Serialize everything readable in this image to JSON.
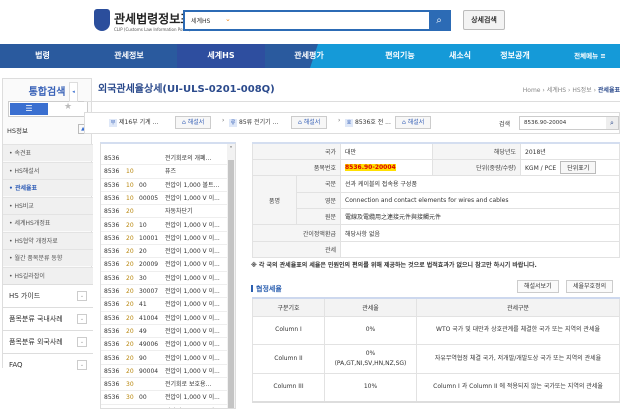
{
  "header": {
    "logo_title": "관세법령정보포털",
    "logo_sub": "CLIP (Customs Law Information Portal)",
    "search_scope": "세계HS",
    "search_value": "",
    "advanced_search": "상세검색"
  },
  "nav": {
    "items": [
      "법령",
      "관세정보",
      "세계HS",
      "관세평가",
      "편의기능",
      "새소식",
      "정보공개",
      "전체메뉴 ≡"
    ],
    "active": "세계HS"
  },
  "sidebar": {
    "title": "통합검색",
    "section": "HS정보",
    "subitems": [
      "속견표",
      "HS해설서",
      "관세율표",
      "HS비교",
      "세계HS개정표",
      "HS협약 개정자료",
      "월간 품목분류 동향",
      "HS길라잡이"
    ],
    "active": "관세율표",
    "groups": [
      "HS 가이드",
      "품목분류 국내사례",
      "품목분류 외국사례",
      "FAQ"
    ]
  },
  "page": {
    "title": "외국관세율상세(UI-ULS-0201-008Q)",
    "breadcrumb": [
      "Home",
      "세계HS",
      "HS정보",
      "관세율표"
    ]
  },
  "filter": {
    "chips": [
      {
        "k": "부",
        "text": "제16부 기계 ..."
      },
      {
        "k": "류",
        "text": "85류 전기기 ..."
      },
      {
        "k": "호",
        "text": "8536호 전 ..."
      }
    ],
    "btn": "해설서",
    "search_label": "검색",
    "search_value": "8536.90-20004"
  },
  "list": [
    [
      "8536",
      "",
      "",
      "전기회로의 개폐..."
    ],
    [
      "8536",
      "10",
      "",
      "퓨즈"
    ],
    [
      "8536",
      "10",
      "00",
      "전압이 1,000 볼트..."
    ],
    [
      "8536",
      "10",
      "00005",
      "전압이 1,000 V 이..."
    ],
    [
      "8536",
      "20",
      "",
      "자동차단기"
    ],
    [
      "8536",
      "20",
      "10",
      "전압이 1,000 V 이..."
    ],
    [
      "8536",
      "20",
      "10001",
      "전압이 1,000 V 이..."
    ],
    [
      "8536",
      "20",
      "20",
      "전압이 1,000 V 이..."
    ],
    [
      "8536",
      "20",
      "20009",
      "전압이 1,000 V 이..."
    ],
    [
      "8536",
      "20",
      "30",
      "전압이 1,000 V 이..."
    ],
    [
      "8536",
      "20",
      "30007",
      "전압이 1,000 V 이..."
    ],
    [
      "8536",
      "20",
      "41",
      "전압이 1,000 V 이..."
    ],
    [
      "8536",
      "20",
      "41004",
      "전압이 1,000 V 이..."
    ],
    [
      "8536",
      "20",
      "49",
      "전압이 1,000 V 이..."
    ],
    [
      "8536",
      "20",
      "49006",
      "전압이 1,000 V 이..."
    ],
    [
      "8536",
      "20",
      "90",
      "전압이 1,000 V 이..."
    ],
    [
      "8536",
      "20",
      "90004",
      "전압이 1,000 V 이..."
    ],
    [
      "8536",
      "30",
      "",
      "전기회로 보호용..."
    ],
    [
      "8536",
      "30",
      "00",
      "전압이 1,000 V 이..."
    ],
    [
      "8536",
      "30",
      "00001",
      "전압이 1,000 V 이..."
    ]
  ],
  "detail": {
    "country_label": "국가",
    "country": "대만",
    "year_label": "해당년도",
    "year": "2018년",
    "code_label": "품목번호",
    "code": "8536.90-20004",
    "unit_label": "단위(중량/수량)",
    "unit": "KGM / PCE",
    "unit_btn": "단위표기",
    "name_label": "품명",
    "kr_label": "국문",
    "kr": "선과 케이블의 접속용 구성품",
    "en_label": "영문",
    "en": "Connection and contact elements for wires and cables",
    "orig_label": "원문",
    "orig": "電線及電纜用之連接元件與接觸元件",
    "refund_label": "간이정액환급",
    "refund": "해당사항 없음",
    "tax_label": "관세",
    "tax": ""
  },
  "note": "※ 각 국의 관세율표의 세율은 민원인의 편의를 위해 제공하는 것으로 법적효과가 없으니 참고만 하시기 바랍니다.",
  "fta": {
    "title": "협정세율",
    "btn_explain": "해설서보기",
    "btn_symbol": "세율부호정의",
    "headers": [
      "구분기호",
      "관세율",
      "관세구분"
    ],
    "rows": [
      [
        "Column I",
        "0%",
        "WTO 국가 및 대만과 상호관계를 체결한 국가 또는 지역의 관세율"
      ],
      [
        "Column II",
        "0% (PA,GT,NI,SV,HN,NZ,SG)",
        "자유무역협정 체결 국가, 저개발/개발도상 국가 또는 지역의 관세율"
      ],
      [
        "Column III",
        "10%",
        "Column I 과 Column II 에 적용되지 않는 국가또는 지역의 관세율"
      ]
    ]
  },
  "colors": {
    "nav_dark": "#2a5a9e",
    "nav_light": "#159ad8",
    "accent": "#2b4a8c",
    "highlight": "#ffe000"
  }
}
